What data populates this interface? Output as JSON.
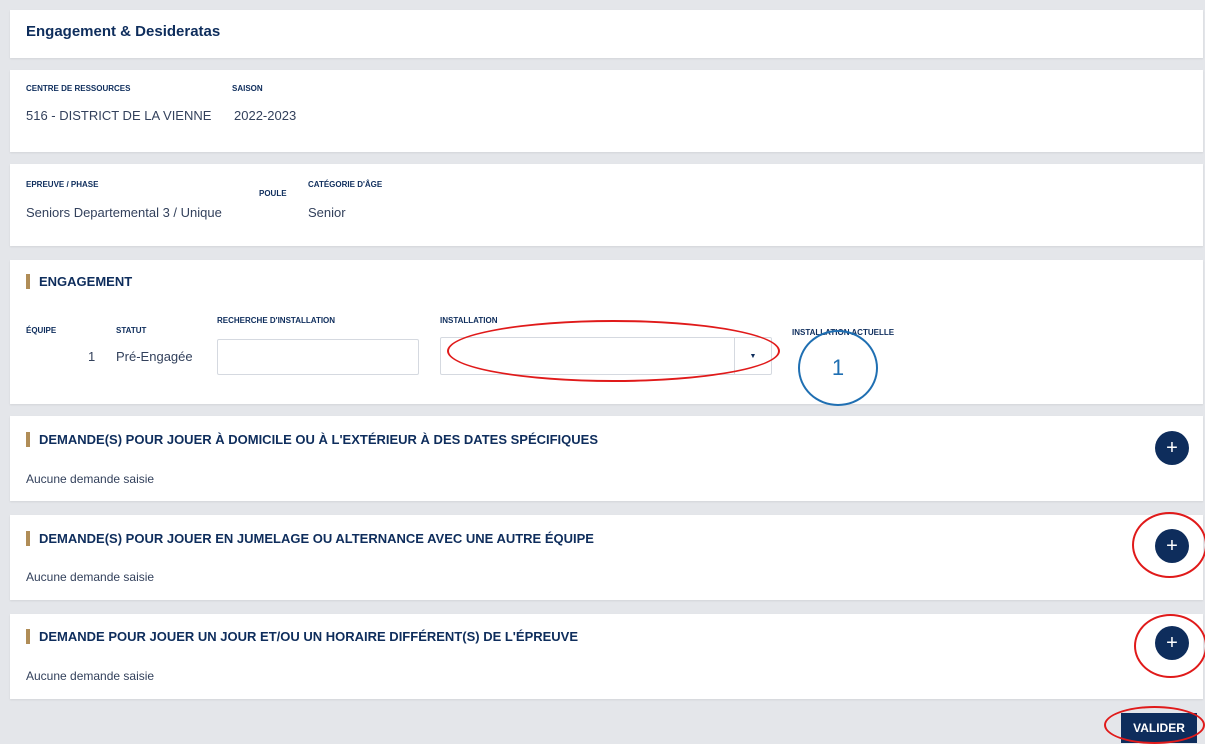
{
  "page_title": "Engagement & Desideratas",
  "info1": {
    "centre_label": "CENTRE DE RESSOURCES",
    "centre_value": "516 - DISTRICT DE LA VIENNE",
    "saison_label": "SAISON",
    "saison_value": "2022-2023"
  },
  "info2": {
    "epreuve_label": "EPREUVE / PHASE",
    "epreuve_value": "Seniors Departemental 3 / Unique",
    "poule_label": "POULE",
    "categorie_label": "CATÉGORIE D'ÂGE",
    "categorie_value": "Senior"
  },
  "engagement": {
    "title": "ENGAGEMENT",
    "equipe_label": "ÉQUIPE",
    "equipe_value": "1",
    "statut_label": "STATUT",
    "statut_value": "Pré-Engagée",
    "recherche_label": "RECHERCHE D'INSTALLATION",
    "recherche_value": "",
    "installation_label": "INSTALLATION",
    "installation_value": "",
    "installation_actuelle_label": "INSTALLATION ACTUELLE",
    "annotation_number": "1"
  },
  "sections": [
    {
      "title": "DEMANDE(S) POUR JOUER À DOMICILE OU À L'EXTÉRIEUR À DES DATES SPÉCIFIQUES",
      "empty_text": "Aucune demande saisie",
      "add_label": "+"
    },
    {
      "title": "DEMANDE(S) POUR JOUER EN JUMELAGE OU ALTERNANCE AVEC UNE AUTRE ÉQUIPE",
      "empty_text": "Aucune demande saisie",
      "add_label": "+"
    },
    {
      "title": "DEMANDE POUR JOUER UN JOUR ET/OU UN HORAIRE DIFFÉRENT(S) DE L'ÉPREUVE",
      "empty_text": "Aucune demande saisie",
      "add_label": "+"
    }
  ],
  "valider_label": "VALIDER",
  "colors": {
    "navy": "#0e2d5c",
    "accent_bar": "#b08d57",
    "annotation_red": "#e01a1a",
    "annotation_blue": "#1f6fb2"
  }
}
